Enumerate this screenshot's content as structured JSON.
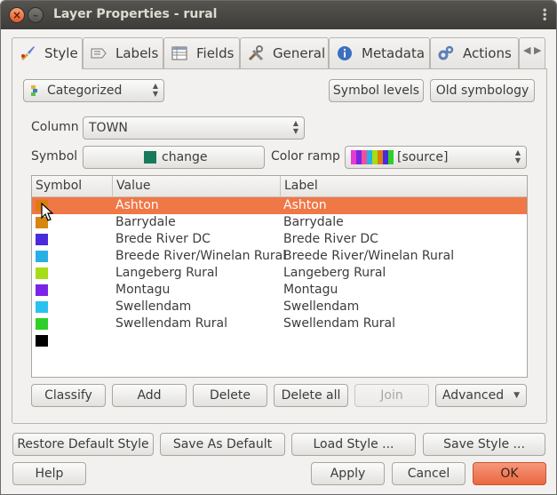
{
  "window": {
    "title": "Layer Properties - rural"
  },
  "tabs": [
    {
      "label": "Style",
      "icon": "brush-icon"
    },
    {
      "label": "Labels",
      "icon": "label-icon"
    },
    {
      "label": "Fields",
      "icon": "table-icon"
    },
    {
      "label": "General",
      "icon": "tools-icon"
    },
    {
      "label": "Metadata",
      "icon": "info-icon"
    },
    {
      "label": "Actions",
      "icon": "gears-icon"
    }
  ],
  "renderer": {
    "selected": "Categorized"
  },
  "top_buttons": {
    "symbol_levels": "Symbol levels",
    "old_symbology": "Old symbology"
  },
  "column": {
    "label": "Column",
    "value": "TOWN"
  },
  "symbol": {
    "label": "Symbol",
    "button": "change",
    "color": "#177a5d"
  },
  "color_ramp": {
    "label": "Color ramp",
    "value": "[source]"
  },
  "table": {
    "headers": [
      "Symbol",
      "Value",
      "Label"
    ],
    "rows": [
      {
        "color": "#e07b10",
        "value": "Ashton",
        "label": "Ashton",
        "selected": true
      },
      {
        "color": "#d8860f",
        "value": "Barrydale",
        "label": "Barrydale"
      },
      {
        "color": "#4a2bdc",
        "value": "Brede River DC",
        "label": "Brede River DC"
      },
      {
        "color": "#27b0e6",
        "value": "Breede River/Winelan Rural",
        "label": "Breede River/Winelan Rural"
      },
      {
        "color": "#a6dd17",
        "value": "Langeberg Rural",
        "label": "Langeberg Rural"
      },
      {
        "color": "#7b24e8",
        "value": "Montagu",
        "label": "Montagu"
      },
      {
        "color": "#29c2ef",
        "value": "Swellendam",
        "label": "Swellendam"
      },
      {
        "color": "#2fcf2a",
        "value": "Swellendam Rural",
        "label": "Swellendam Rural"
      },
      {
        "color": "#000000",
        "value": "",
        "label": ""
      }
    ]
  },
  "table_buttons": {
    "classify": "Classify",
    "add": "Add",
    "delete": "Delete",
    "delete_all": "Delete all",
    "join": "Join",
    "advanced": "Advanced"
  },
  "style_buttons": {
    "restore": "Restore Default Style",
    "save_default": "Save As Default",
    "load": "Load Style ...",
    "save": "Save Style ..."
  },
  "dialog_buttons": {
    "help": "Help",
    "apply": "Apply",
    "cancel": "Cancel",
    "ok": "OK"
  },
  "colors": {
    "selection": "#f07746",
    "ok_button": "#e9683f",
    "titlebar": "#3d3c38"
  }
}
